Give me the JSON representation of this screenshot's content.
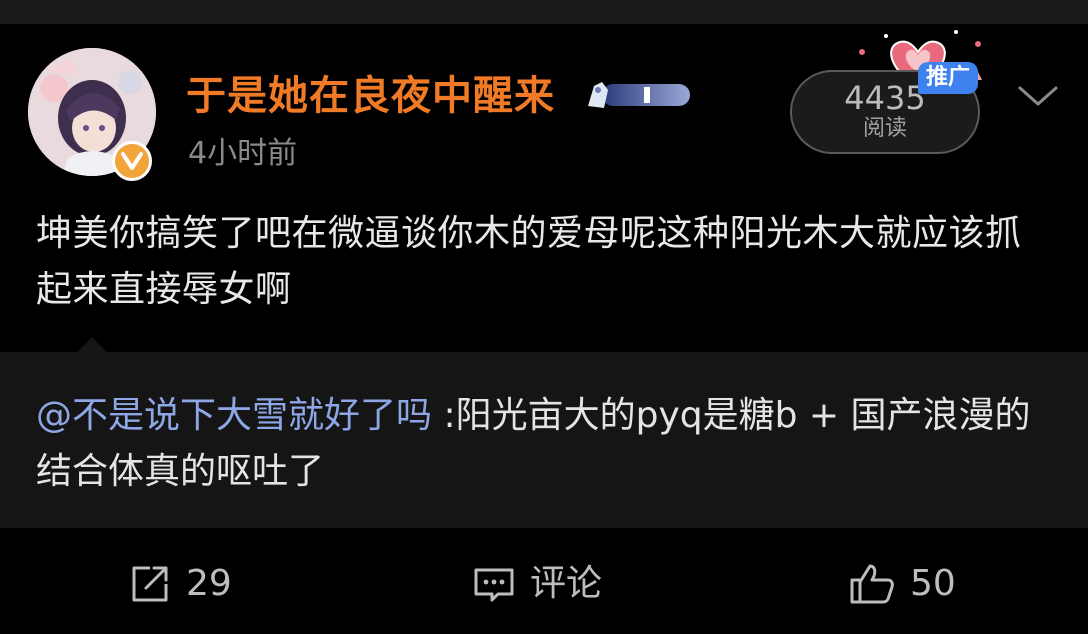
{
  "post": {
    "user_name": "于是她在良夜中醒来",
    "time": "4小时前",
    "read_count": "4435",
    "read_label": "阅读",
    "promo_tag": "推广",
    "body": "坤美你搞笑了吧在微逼谈你木的爱母呢这种阳光木大就应该抓起来直接辱女啊"
  },
  "repost": {
    "mention": "@不是说下大雪就好了吗",
    "text": " :阳光亩大的pyq是糖b + 国产浪漫的结合体真的呕吐了"
  },
  "actions": {
    "share_count": "29",
    "comment_label": "评论",
    "like_count": "50"
  },
  "colors": {
    "user_name": "#f07a26",
    "mention": "#8fa6e6",
    "promo_tag": "#3d82ee",
    "verified_badge": "#f2a43a"
  }
}
